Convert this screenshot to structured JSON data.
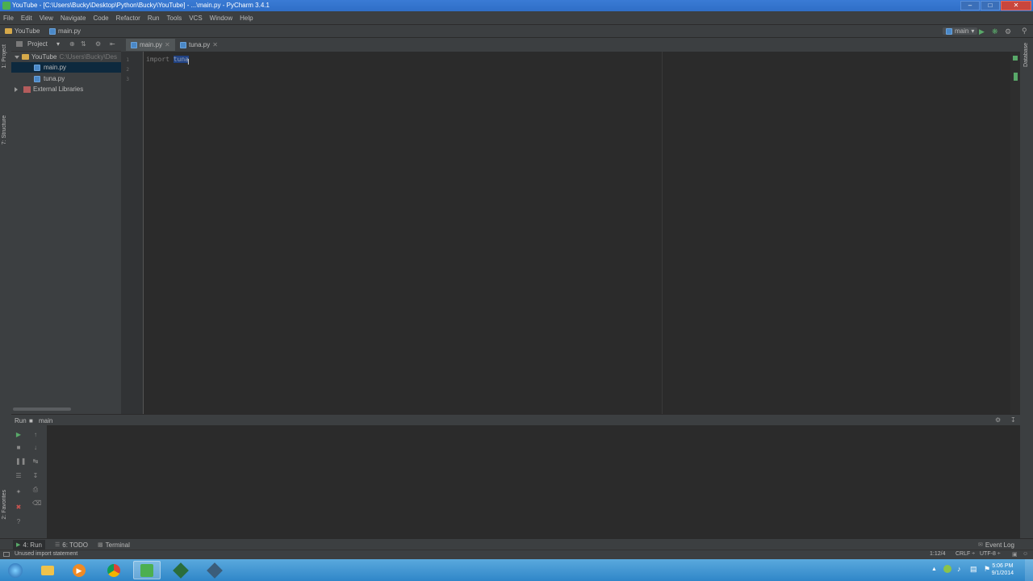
{
  "window": {
    "title": "YouTube - [C:\\Users\\Bucky\\Desktop\\Python\\Bucky\\YouTube] - ...\\main.py - PyCharm 3.4.1",
    "controls": {
      "minimize": "–",
      "maximize": "□",
      "close": "✕"
    }
  },
  "menu": [
    "File",
    "Edit",
    "View",
    "Navigate",
    "Code",
    "Refactor",
    "Run",
    "Tools",
    "VCS",
    "Window",
    "Help"
  ],
  "navbar": {
    "crumbs": [
      "YouTube",
      "main.py"
    ],
    "run_config": "main"
  },
  "left_strip": {
    "tabs": [
      "1: Project",
      "7: Structure",
      "2: Favorites"
    ]
  },
  "project": {
    "header_label": "Project",
    "tree": [
      {
        "label": "YouTube",
        "path": "C:\\Users\\Bucky\\Des",
        "icon": "folder-icon"
      },
      {
        "label": "main.py",
        "icon": "python-file-icon",
        "selected": true
      },
      {
        "label": "tuna.py",
        "icon": "python-file-icon"
      },
      {
        "label": "External Libraries",
        "icon": "library-icon"
      }
    ]
  },
  "editor": {
    "tabs": [
      {
        "label": "main.py",
        "active": true
      },
      {
        "label": "tuna.py",
        "active": false
      }
    ],
    "line_numbers": [
      "1",
      "2",
      "3"
    ],
    "code": {
      "keyword": "import ",
      "module": "tuna"
    }
  },
  "right_strip": {
    "tab": "Database"
  },
  "run_panel": {
    "label": "Run",
    "config": "main"
  },
  "bottom_tabs": [
    {
      "label": "4: Run"
    },
    {
      "label": "6: TODO"
    },
    {
      "label": "Terminal"
    }
  ],
  "event_log": "Event Log",
  "status": {
    "message": "Unused import statement",
    "position": "1:12/4",
    "line_sep": "CRLF ÷",
    "encoding": "UTF-8 ÷"
  },
  "taskbar": {
    "time": "5:06 PM",
    "date": "9/1/2014"
  },
  "colors": {
    "ide_bg": "#2b2b2b",
    "panel_bg": "#3c3f41",
    "selection": "#214283",
    "titlebar": "#3a7bd5",
    "taskbar": "#2f86c8"
  }
}
